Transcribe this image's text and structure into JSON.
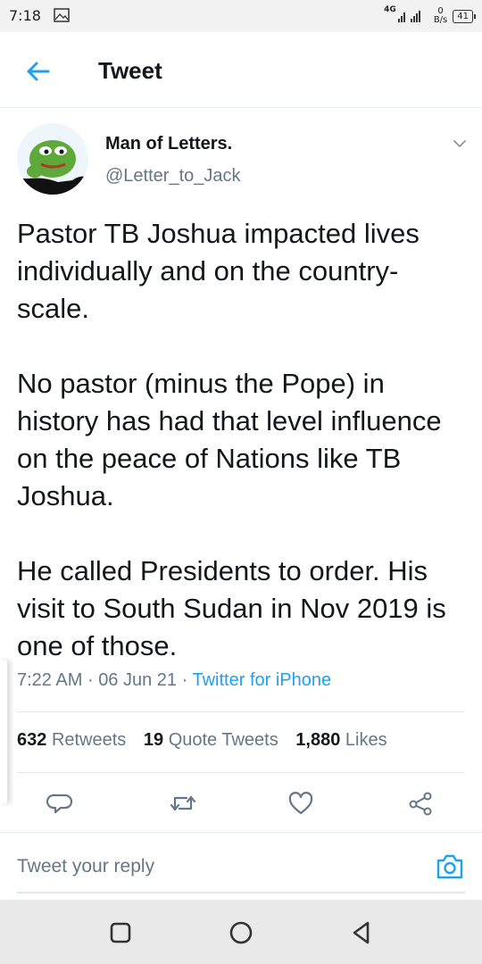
{
  "status_bar": {
    "time": "7:18",
    "network": "4G",
    "speed_value": "0",
    "speed_unit": "B/s",
    "battery": "41"
  },
  "header": {
    "title": "Tweet"
  },
  "tweet": {
    "author_name": "Man of Letters.",
    "author_handle": "@Letter_to_Jack",
    "paragraphs": [
      "Pastor TB Joshua impacted lives individually and on the country-scale.",
      "No pastor (minus the Pope) in history has had that level influence on the peace of Nations like TB Joshua.",
      "He called Presidents to order. His visit to South Sudan in Nov 2019 is one of those."
    ],
    "time": "7:22 AM",
    "separator": "·",
    "date": "06 Jun 21",
    "source": "Twitter for iPhone"
  },
  "stats": {
    "retweets_count": "632",
    "retweets_label": "Retweets",
    "quotes_count": "19",
    "quotes_label": "Quote Tweets",
    "likes_count": "1,880",
    "likes_label": "Likes"
  },
  "reply": {
    "placeholder": "Tweet your reply"
  },
  "colors": {
    "accent": "#1da1f2",
    "secondary_text": "#657786",
    "divider": "#e1e8ed"
  }
}
